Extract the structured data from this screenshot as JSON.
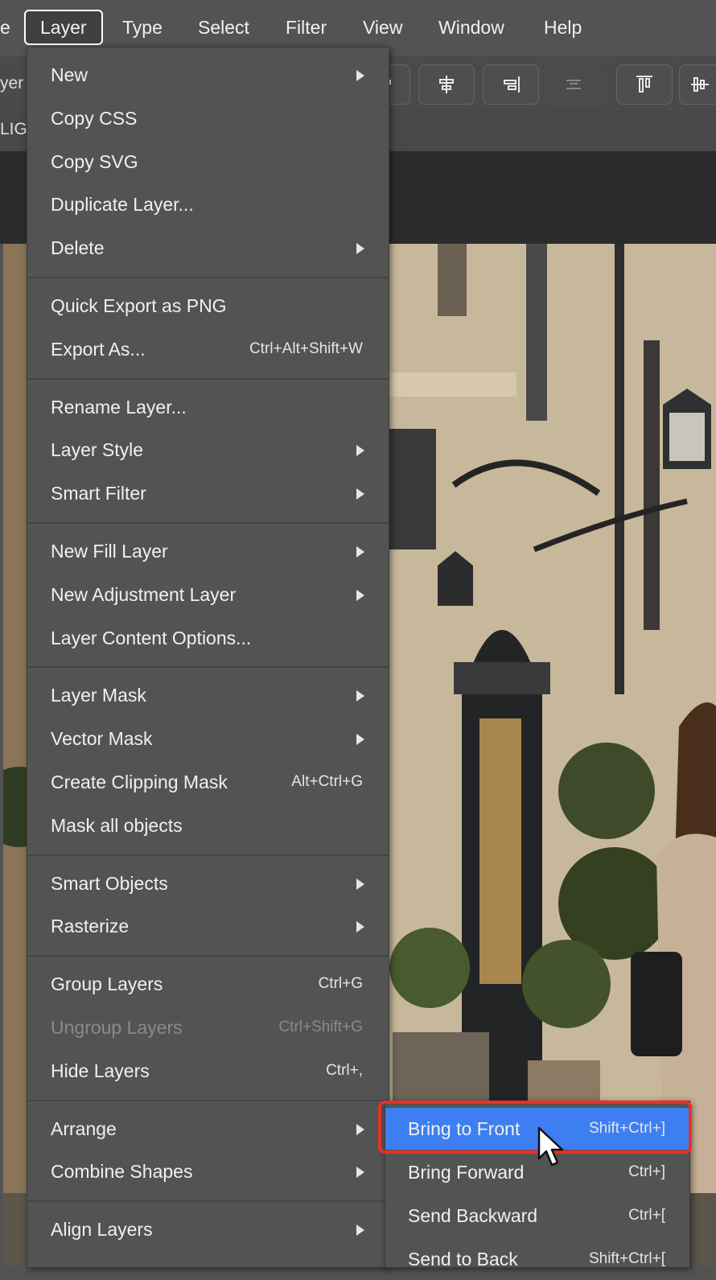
{
  "menubar": {
    "items": [
      "e",
      "Layer",
      "Type",
      "Select",
      "Filter",
      "View",
      "Window",
      "Help"
    ],
    "active": "Layer"
  },
  "toolbar": {
    "left_cut_1": "yer",
    "left_cut_2": "LIG"
  },
  "layer_menu": {
    "groups": [
      [
        {
          "label": "New",
          "submenu": true
        },
        {
          "label": "Copy CSS"
        },
        {
          "label": "Copy SVG"
        },
        {
          "label": "Duplicate Layer..."
        },
        {
          "label": "Delete",
          "submenu": true
        }
      ],
      [
        {
          "label": "Quick Export as PNG"
        },
        {
          "label": "Export As...",
          "shortcut": "Ctrl+Alt+Shift+W"
        }
      ],
      [
        {
          "label": "Rename Layer..."
        },
        {
          "label": "Layer Style",
          "submenu": true
        },
        {
          "label": "Smart Filter",
          "submenu": true
        }
      ],
      [
        {
          "label": "New Fill Layer",
          "submenu": true
        },
        {
          "label": "New Adjustment Layer",
          "submenu": true
        },
        {
          "label": "Layer Content Options..."
        }
      ],
      [
        {
          "label": "Layer Mask",
          "submenu": true
        },
        {
          "label": "Vector Mask",
          "submenu": true
        },
        {
          "label": "Create Clipping Mask",
          "shortcut": "Alt+Ctrl+G"
        },
        {
          "label": "Mask all objects"
        }
      ],
      [
        {
          "label": "Smart Objects",
          "submenu": true
        },
        {
          "label": "Rasterize",
          "submenu": true
        }
      ],
      [
        {
          "label": "Group Layers",
          "shortcut": "Ctrl+G"
        },
        {
          "label": "Ungroup Layers",
          "shortcut": "Ctrl+Shift+G",
          "disabled": true
        },
        {
          "label": "Hide Layers",
          "shortcut": "Ctrl+,"
        }
      ],
      [
        {
          "label": "Arrange",
          "submenu": true
        },
        {
          "label": "Combine Shapes",
          "submenu": true
        }
      ],
      [
        {
          "label": "Align Layers",
          "submenu": true
        }
      ]
    ]
  },
  "arrange_submenu": {
    "items": [
      {
        "label": "Bring to Front",
        "shortcut": "Shift+Ctrl+]",
        "highlighted": true
      },
      {
        "label": "Bring Forward",
        "shortcut": "Ctrl+]"
      },
      {
        "label": "Send Backward",
        "shortcut": "Ctrl+["
      },
      {
        "label": "Send to Back",
        "shortcut": "Shift+Ctrl+["
      }
    ]
  },
  "colors": {
    "menu_bg": "#535353",
    "highlight": "#3d7ff2",
    "callout": "#e8302a"
  }
}
